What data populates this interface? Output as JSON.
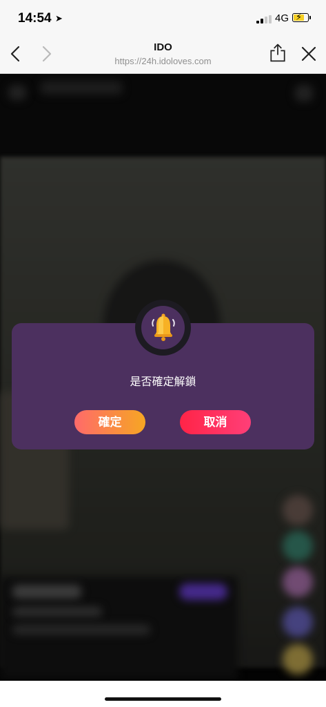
{
  "status_bar": {
    "time": "14:54",
    "network": "4G"
  },
  "browser": {
    "title": "IDO",
    "url": "https://24h.idoloves.com",
    "icons": [
      "chevron-left-icon",
      "chevron-right-icon",
      "share-icon",
      "close-icon"
    ]
  },
  "dialog": {
    "icon": "bell-icon",
    "message": "是否確定解鎖",
    "confirm_label": "確定",
    "cancel_label": "取消",
    "colors": {
      "panel": "#4c305f",
      "confirm_gradient": [
        "#ff6a6a",
        "#f6a623"
      ],
      "cancel_gradient": [
        "#ff2447",
        "#ff3f78"
      ]
    }
  }
}
